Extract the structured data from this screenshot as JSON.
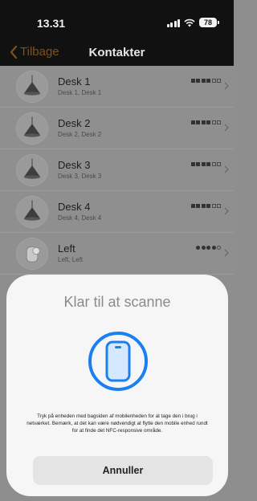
{
  "status": {
    "time": "13.31",
    "battery": "78",
    "icons": [
      "cellular-signal-icon",
      "wifi-icon",
      "battery-icon"
    ]
  },
  "nav": {
    "back_label": "Tilbage",
    "title": "Kontakter",
    "accent_color": "#7a5220"
  },
  "contacts": [
    {
      "name": "Desk 1",
      "subtitle": "Desk 1, Desk 1",
      "icon": "pendant-lamp-icon",
      "indicator": "squares",
      "level": 4,
      "max": 6
    },
    {
      "name": "Desk 2",
      "subtitle": "Desk 2, Desk 2",
      "icon": "pendant-lamp-icon",
      "indicator": "squares",
      "level": 4,
      "max": 6
    },
    {
      "name": "Desk 3",
      "subtitle": "Desk 3, Desk 3",
      "icon": "pendant-lamp-icon",
      "indicator": "squares",
      "level": 4,
      "max": 6
    },
    {
      "name": "Desk 4",
      "subtitle": "Desk 4, Desk 4",
      "icon": "pendant-lamp-icon",
      "indicator": "squares",
      "level": 4,
      "max": 6
    },
    {
      "name": "Left",
      "subtitle": "Left, Left",
      "icon": "wall-light-icon",
      "indicator": "dots",
      "level": 4,
      "max": 5
    }
  ],
  "nfc_sheet": {
    "title": "Klar til at scanne",
    "instructions": "Tryk på enheden med bagsiden af mobilenheden for at tage den i brug i netværket. Bemærk, at det kan være nødvendigt at flytte den mobile enhed rundt for at finde det NFC-responsive område.",
    "cancel_label": "Annuller",
    "icon": "phone-icon",
    "icon_color": "#1a7ff0"
  }
}
